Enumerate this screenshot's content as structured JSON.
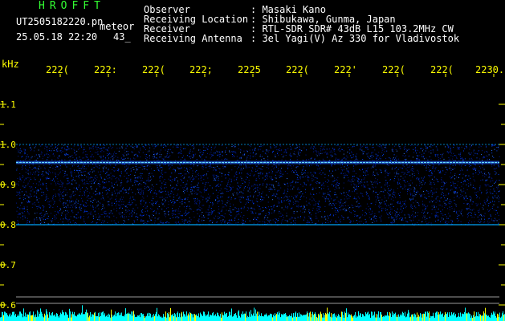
{
  "header": {
    "brand": "HROFFT",
    "filename": "UT2505182220.pn",
    "mode": "meteor",
    "datetime": "25.05.18 22:20",
    "count": "43_"
  },
  "info": [
    {
      "label": "Observer",
      "value": ": Masaki Kano"
    },
    {
      "label": "Receiving Location",
      "value": ": Shibukawa, Gunma, Japan"
    },
    {
      "label": "Receiver",
      "value": ": RTL-SDR SDR# 43dB L15 103.2MHz CW"
    },
    {
      "label": "Receiving Antenna",
      "value": ": 3el Yagi(V) Az 330 for Vladivostok"
    }
  ],
  "axis": {
    "unit": "kHz",
    "x_ticks": [
      "222(",
      "222:",
      "222(",
      "222;",
      "2225",
      "222(",
      "222'",
      "222(",
      "222(",
      "2230."
    ],
    "y_ticks": [
      "1.1",
      "1.0",
      "0.9",
      "0.8",
      "0.7",
      "0.6"
    ]
  },
  "colors": {
    "background": "#000000",
    "label": "#ffffff",
    "axis_text": "#ffff00",
    "brand": "#33ff33",
    "signal": "#0044ff",
    "bright_line": "#66ddff",
    "band_edge": "#00aaff",
    "bottom_trace": "#00ffff"
  },
  "spectrogram": {
    "noise_band_khz": [
      0.8,
      1.0
    ],
    "carrier_khz": 0.955
  }
}
